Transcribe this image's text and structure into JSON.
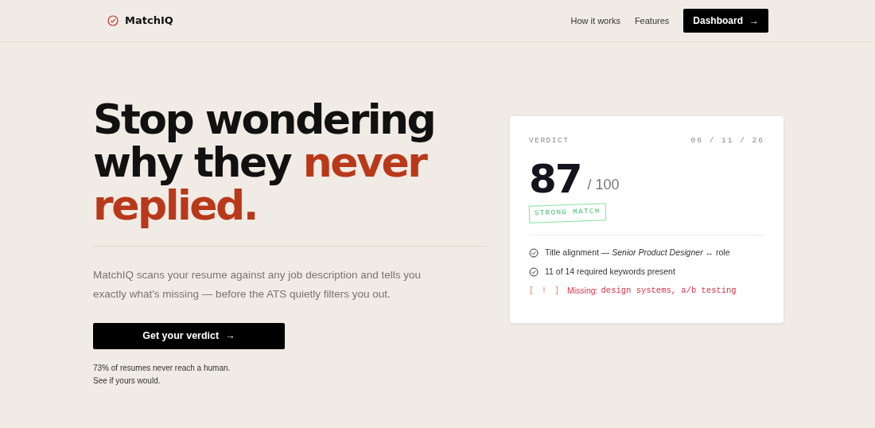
{
  "brand": {
    "name": "MatchIQ"
  },
  "nav": {
    "links": [
      "How it works",
      "Features"
    ],
    "cta": "Dashboard",
    "cta_arrow": "→"
  },
  "hero": {
    "headline": [
      [
        {
          "text": "Stop wondering",
          "accent": false
        }
      ],
      [
        {
          "text": "why they ",
          "accent": false
        },
        {
          "text": "never",
          "accent": true
        }
      ],
      [
        {
          "text": "replied.",
          "accent": true
        }
      ]
    ],
    "lede": "MatchIQ scans your resume against any job description and tells you exactly what's missing — before the ATS quietly filters you out.",
    "cta": "Get your verdict",
    "cta_arrow": "→",
    "footnote": [
      "73% of resumes never reach a human.",
      "See if yours would."
    ]
  },
  "card": {
    "label": "VERDICT",
    "date": "06 / 11 / 26",
    "score": "87",
    "score_max": "/ 100",
    "badge": "STRONG MATCH",
    "items": [
      {
        "kind": "check",
        "text": "Title alignment — *Senior Product Designer* ↔ role"
      },
      {
        "kind": "check",
        "text": "11 of 14 required keywords present"
      },
      {
        "kind": "missing",
        "marker": "[ ! ]",
        "label": "Missing:",
        "code": "design systems, a/b testing"
      }
    ]
  }
}
